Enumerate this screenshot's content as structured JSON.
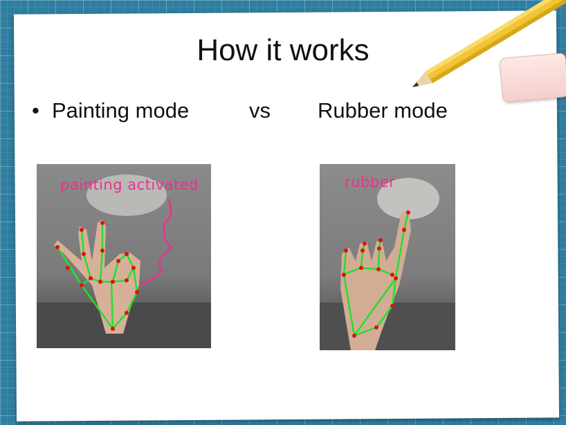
{
  "slide": {
    "title": "How it works",
    "bullet": "•",
    "painting_mode": "Painting mode",
    "vs": "vs",
    "rubber_mode": "Rubber mode"
  },
  "images": {
    "painting": {
      "overlay_text": "painting activated"
    },
    "rubber": {
      "overlay_text": "rubber"
    }
  },
  "colors": {
    "background": "#2f7ea0",
    "overlay_text": "#e8338c",
    "skeleton": "#22e02a",
    "landmark": "#e01010"
  }
}
